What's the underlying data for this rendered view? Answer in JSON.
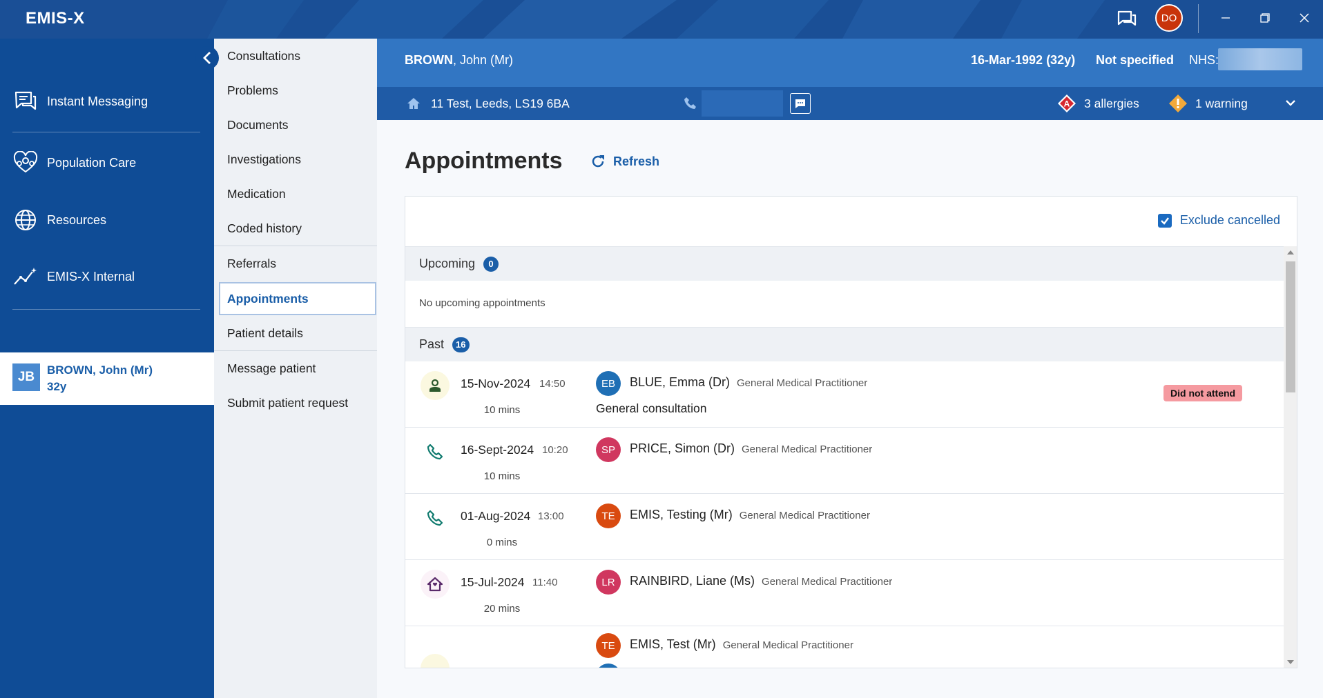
{
  "app": {
    "logo": "EMIS-X",
    "user_initials": "DO"
  },
  "left_nav": {
    "items": [
      {
        "label": "Instant Messaging",
        "icon": "chat-icon"
      },
      {
        "label": "Population Care",
        "icon": "population-care-icon"
      },
      {
        "label": "Resources",
        "icon": "globe-icon"
      },
      {
        "label": "EMIS-X Internal",
        "icon": "trend-icon"
      }
    ],
    "patient": {
      "initials": "JB",
      "name": "BROWN, John (Mr)",
      "age": "32y"
    }
  },
  "sub_nav": {
    "items": [
      "Consultations",
      "Problems",
      "Documents",
      "Investigations",
      "Medication",
      "Coded history",
      "Referrals",
      "Appointments",
      "Patient details",
      "Message patient",
      "Submit patient request"
    ],
    "active": "Appointments"
  },
  "banner": {
    "surname": "BROWN",
    "given": ", John (Mr)",
    "dob": "16-Mar-1992 (32y)",
    "gender": "Not specified",
    "nhs_label": "NHS:",
    "address": "11 Test, Leeds, LS19 6BA",
    "allergies": "3 allergies",
    "warnings": "1 warning"
  },
  "main": {
    "title": "Appointments",
    "refresh": "Refresh",
    "exclude_cancelled": "Exclude cancelled",
    "upcoming": {
      "label": "Upcoming",
      "count": "0",
      "empty_text": "No upcoming appointments"
    },
    "past": {
      "label": "Past",
      "count": "16"
    },
    "appointments": [
      {
        "type_icon": "face-to-face-icon",
        "date": "15-Nov-2024",
        "time": "14:50",
        "duration": "10 mins",
        "initials": "EB",
        "avatar_color": "#1f6fb5",
        "clinician": "BLUE, Emma (Dr)",
        "role": "General Medical Practitioner",
        "reason": "General consultation",
        "status": "Did not attend"
      },
      {
        "type_icon": "phone-icon",
        "date": "16-Sept-2024",
        "time": "10:20",
        "duration": "10 mins",
        "initials": "SP",
        "avatar_color": "#d0375f",
        "clinician": "PRICE, Simon (Dr)",
        "role": "General Medical Practitioner",
        "reason": "",
        "status": ""
      },
      {
        "type_icon": "phone-icon",
        "date": "01-Aug-2024",
        "time": "13:00",
        "duration": "0 mins",
        "initials": "TE",
        "avatar_color": "#d94a10",
        "clinician": "EMIS, Testing (Mr)",
        "role": "General Medical Practitioner",
        "reason": "",
        "status": ""
      },
      {
        "type_icon": "home-visit-icon",
        "date": "15-Jul-2024",
        "time": "11:40",
        "duration": "20 mins",
        "initials": "LR",
        "avatar_color": "#d0375f",
        "clinician": "RAINBIRD, Liane (Ms)",
        "role": "General Medical Practitioner",
        "reason": "",
        "status": ""
      },
      {
        "type_icon": "face-to-face-icon",
        "date": "",
        "time": "",
        "duration": "",
        "initials": "TE",
        "avatar_color": "#d94a10",
        "clinician": "EMIS, Test (Mr)",
        "role": "General Medical Practitioner",
        "reason": "",
        "status": ""
      }
    ]
  }
}
